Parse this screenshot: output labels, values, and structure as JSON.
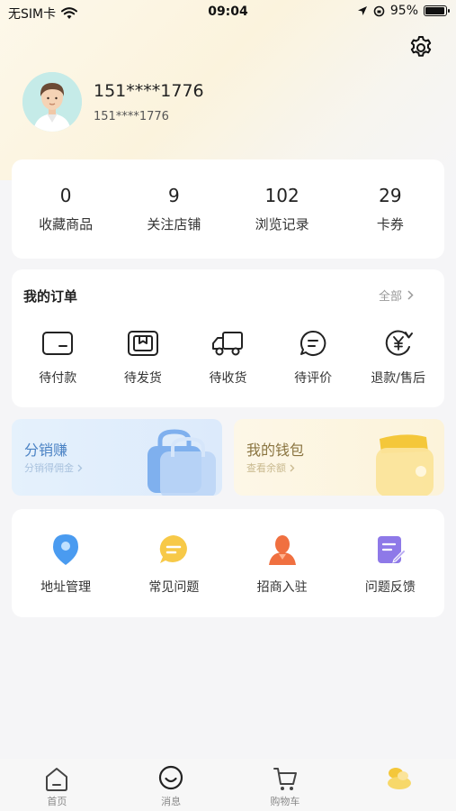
{
  "status_bar": {
    "carrier": "无SIM卡",
    "time": "09:04",
    "battery": "95%",
    "battery_level": 0.95
  },
  "profile": {
    "nickname": "151****1776",
    "phone": "151****1776"
  },
  "stats": [
    {
      "value": "0",
      "label": "收藏商品"
    },
    {
      "value": "9",
      "label": "关注店铺"
    },
    {
      "value": "102",
      "label": "浏览记录"
    },
    {
      "value": "29",
      "label": "卡券"
    }
  ],
  "orders": {
    "title": "我的订单",
    "all_label": "全部",
    "items": [
      {
        "label": "待付款",
        "icon": "wallet-card-icon"
      },
      {
        "label": "待发货",
        "icon": "package-box-icon"
      },
      {
        "label": "待收货",
        "icon": "delivery-truck-icon"
      },
      {
        "label": "待评价",
        "icon": "comment-bubble-icon"
      },
      {
        "label": "退款/售后",
        "icon": "yen-refund-icon"
      }
    ]
  },
  "promos": {
    "distribution": {
      "title": "分销赚",
      "subtitle": "分销得佣金",
      "color": "#4a82c4"
    },
    "wallet": {
      "title": "我的钱包",
      "subtitle": "查看余额",
      "color": "#8a7440"
    }
  },
  "services": [
    {
      "label": "地址管理",
      "icon": "location-pin-icon"
    },
    {
      "label": "常见问题",
      "icon": "chat-bubble-icon"
    },
    {
      "label": "招商入驻",
      "icon": "person-bust-icon"
    },
    {
      "label": "问题反馈",
      "icon": "feedback-edit-icon"
    }
  ],
  "tabbar": [
    {
      "label": "首页",
      "icon": "home-icon"
    },
    {
      "label": "消息",
      "icon": "message-icon"
    },
    {
      "label": "购物车",
      "icon": "cart-icon"
    },
    {
      "label": "",
      "icon": "profile-coins-icon",
      "active": true
    }
  ],
  "colors": {
    "accent_yellow": "#f7c948",
    "pin_blue": "#4a9bf0",
    "bust_orange": "#f07040",
    "feedback_purple": "#8e79e8"
  }
}
